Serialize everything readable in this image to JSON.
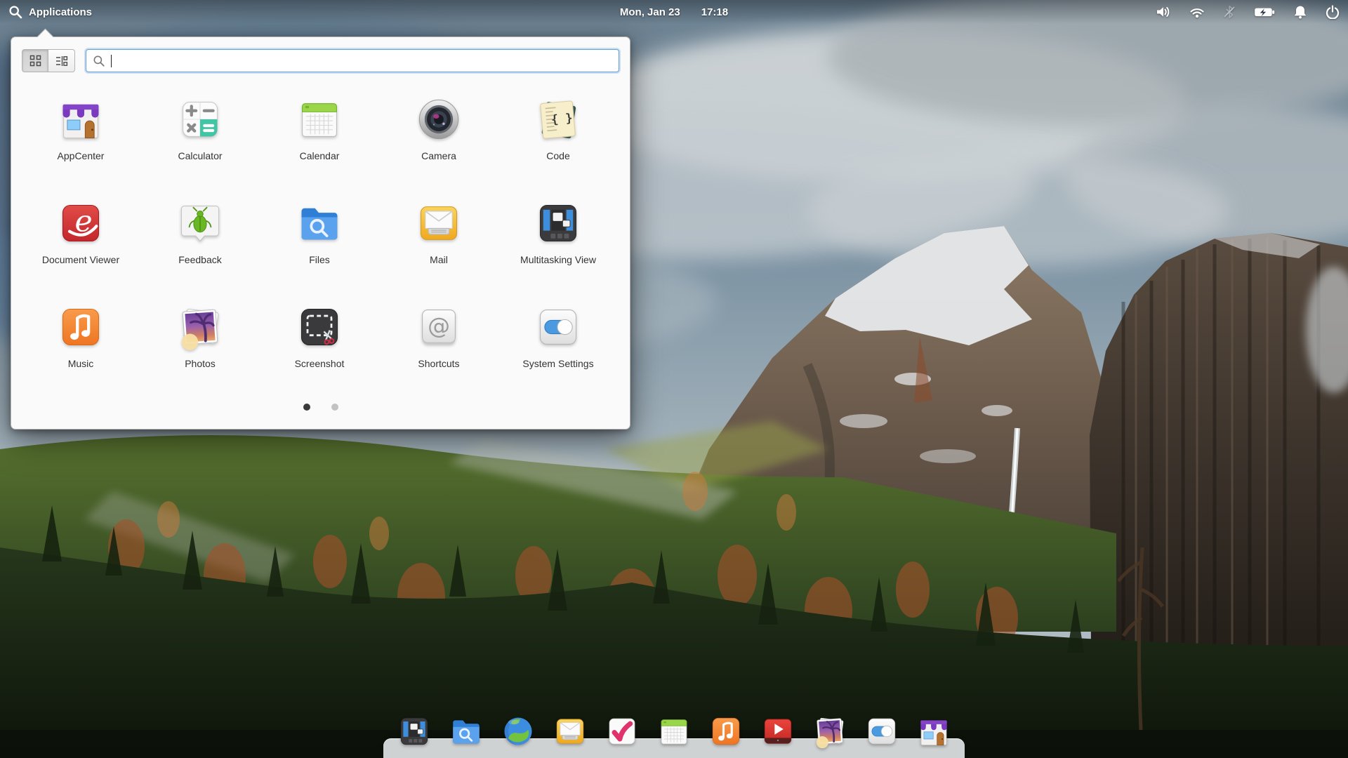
{
  "panel": {
    "app_menu_label": "Applications",
    "date": "Mon, Jan 23",
    "time": "17:18",
    "indicators": [
      "volume",
      "wifi",
      "bluetooth-disabled",
      "battery-charging",
      "notifications",
      "power"
    ]
  },
  "launcher": {
    "view_toggle": {
      "options": [
        "grid-view",
        "list-view"
      ],
      "active": "grid-view"
    },
    "search": {
      "value": "",
      "placeholder": ""
    },
    "apps": [
      {
        "label": "AppCenter",
        "icon": "appcenter"
      },
      {
        "label": "Calculator",
        "icon": "calculator"
      },
      {
        "label": "Calendar",
        "icon": "calendar"
      },
      {
        "label": "Camera",
        "icon": "camera"
      },
      {
        "label": "Code",
        "icon": "code"
      },
      {
        "label": "Document Viewer",
        "icon": "docviewer"
      },
      {
        "label": "Feedback",
        "icon": "feedback"
      },
      {
        "label": "Files",
        "icon": "files"
      },
      {
        "label": "Mail",
        "icon": "mail"
      },
      {
        "label": "Multitasking View",
        "icon": "multitasking"
      },
      {
        "label": "Music",
        "icon": "music"
      },
      {
        "label": "Photos",
        "icon": "photos"
      },
      {
        "label": "Screenshot",
        "icon": "screenshot"
      },
      {
        "label": "Shortcuts",
        "icon": "shortcuts"
      },
      {
        "label": "System Settings",
        "icon": "settings"
      }
    ],
    "pages": {
      "total": 2,
      "active_index": 0
    }
  },
  "dock": {
    "items": [
      {
        "name": "Multitasking View",
        "icon": "multitasking"
      },
      {
        "name": "Files",
        "icon": "files"
      },
      {
        "name": "Web",
        "icon": "web"
      },
      {
        "name": "Mail",
        "icon": "mail"
      },
      {
        "name": "Tasks",
        "icon": "tasks"
      },
      {
        "name": "Calendar",
        "icon": "calendar"
      },
      {
        "name": "Music",
        "icon": "music"
      },
      {
        "name": "Videos",
        "icon": "videos"
      },
      {
        "name": "Photos",
        "icon": "photos"
      },
      {
        "name": "System Settings",
        "icon": "settings"
      },
      {
        "name": "AppCenter",
        "icon": "appcenter"
      }
    ]
  },
  "colors": {
    "accent": "#3689e6",
    "launcher_bg": "#fafafa",
    "panel_text": "#ffffff",
    "dock_bg": "#dfe1e3"
  }
}
